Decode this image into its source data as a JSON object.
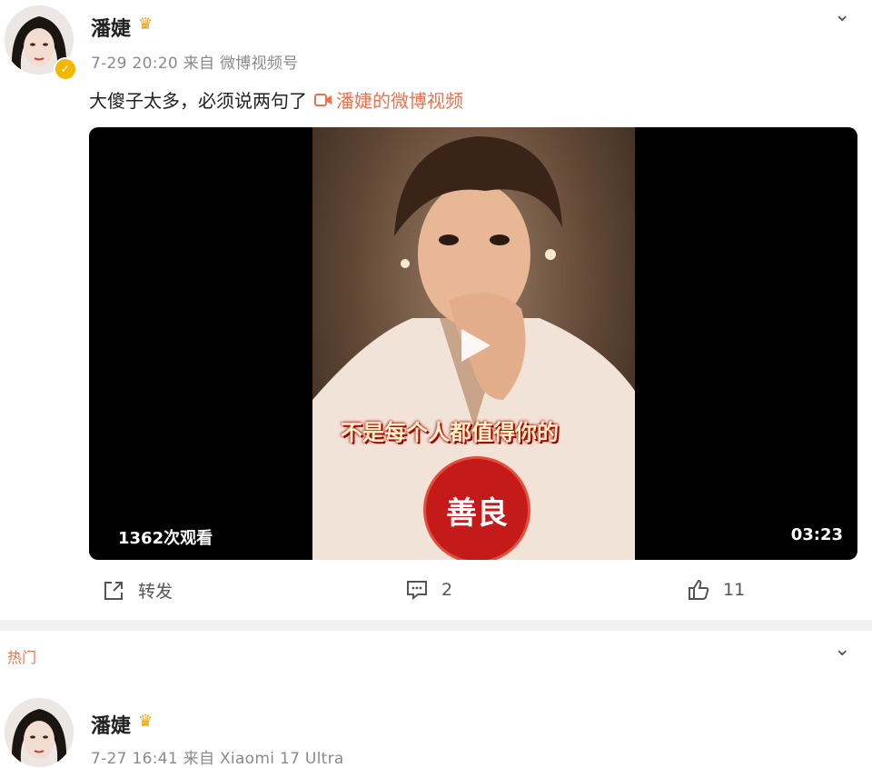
{
  "post1": {
    "author": "潘婕",
    "meta": "7-29 20:20 来自 微博视频号",
    "text": "大傻子太多，必须说两句了",
    "video_link": "潘婕的微博视频",
    "video": {
      "caption": "不是每个人都值得你的",
      "seal_text": "善良",
      "views": "1362次观看",
      "duration": "03:23"
    },
    "actions": {
      "repost": "转发",
      "comments": "2",
      "likes": "11"
    }
  },
  "section": {
    "label": "热门"
  },
  "post2": {
    "author": "潘婕",
    "meta": "7-27 16:41 来自 Xiaomi 17 Ultra"
  },
  "icons": {
    "verified": "verified-badge-icon",
    "crown": "crown-icon",
    "video": "video-icon",
    "play": "play-icon",
    "repost": "repost-icon",
    "comment": "comment-icon",
    "like": "like-icon",
    "chevron": "chevron-down-icon"
  },
  "colors": {
    "link": "#eb7350",
    "verified": "#f5b800",
    "seal": "#c41a1a"
  }
}
